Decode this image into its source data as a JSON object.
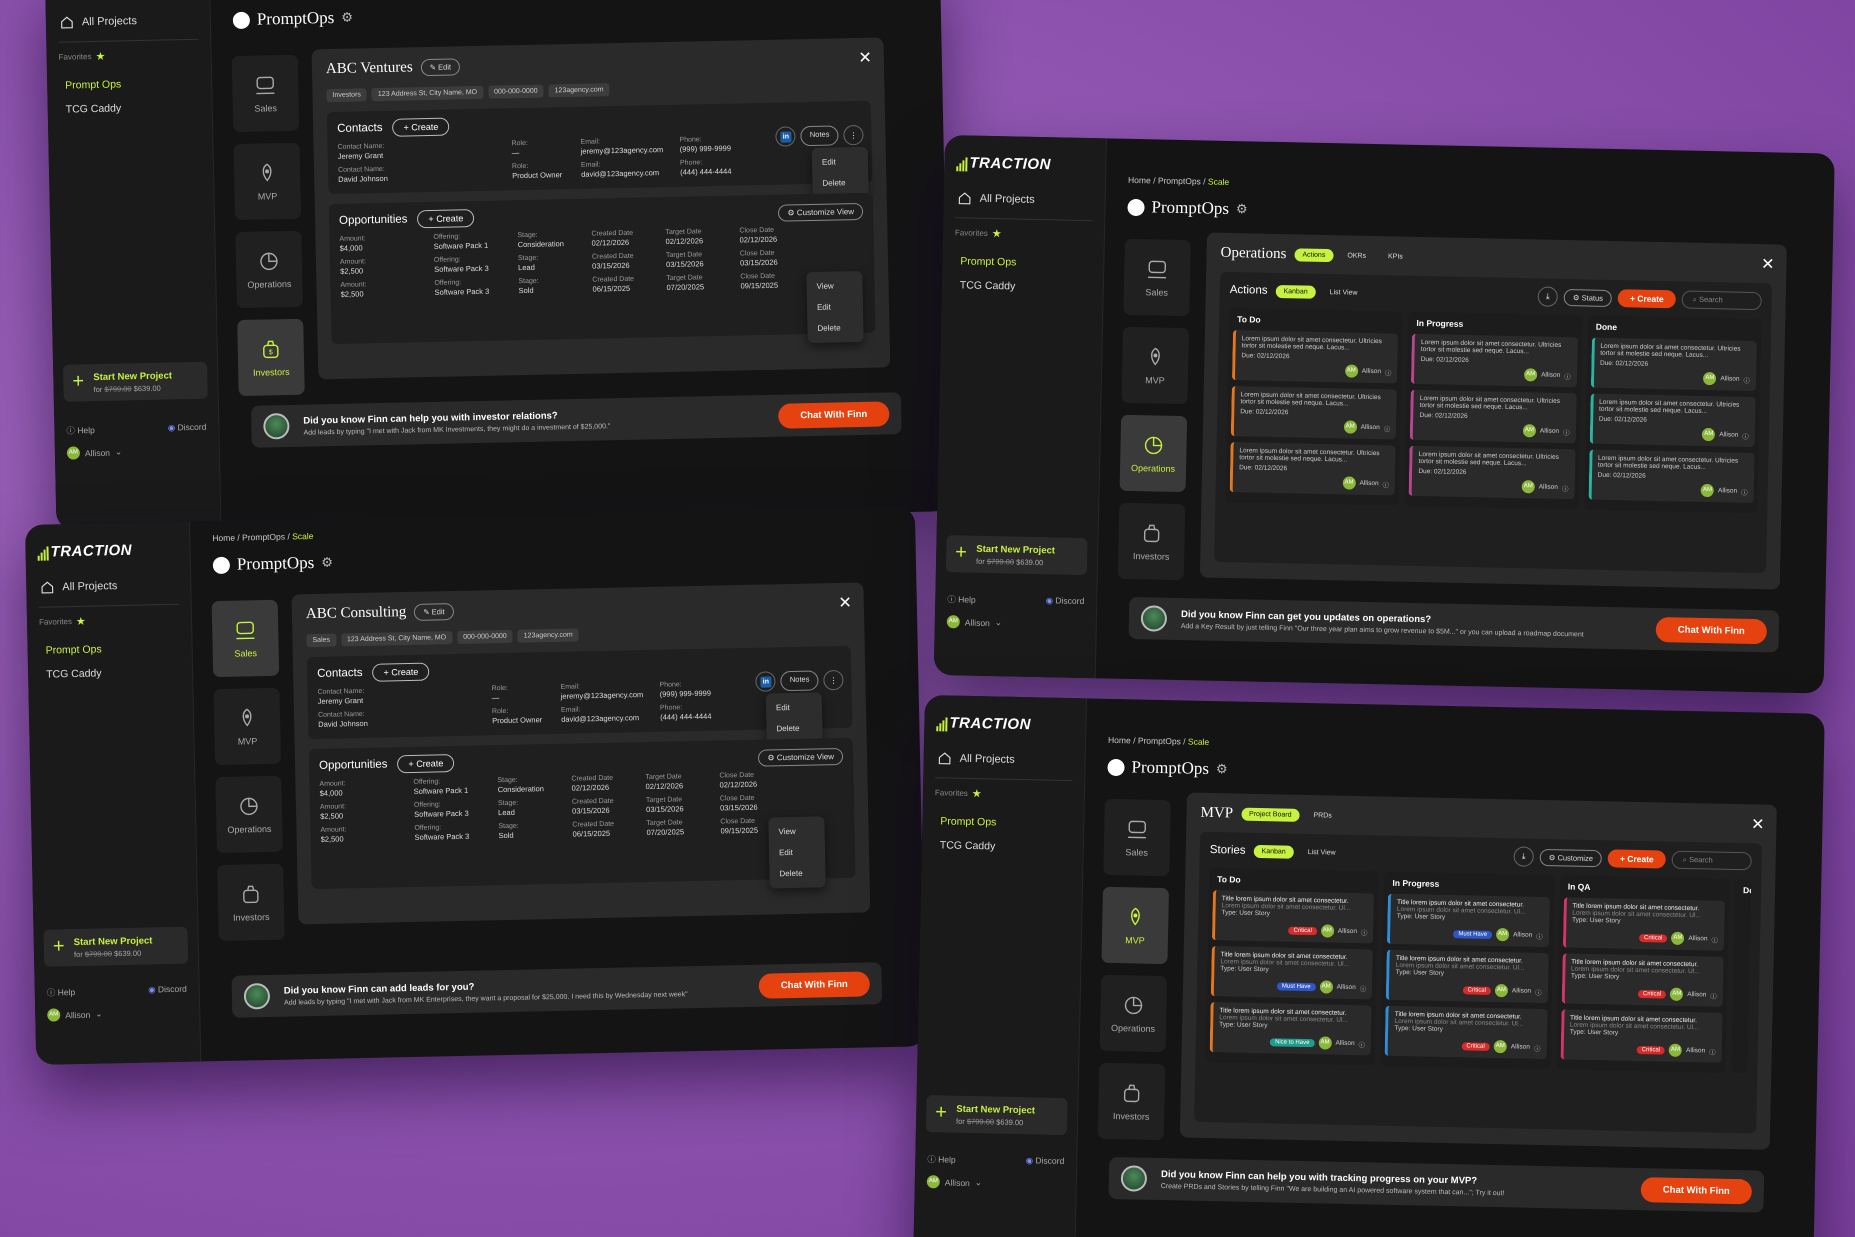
{
  "common": {
    "logo": "TRACTION",
    "all_projects": "All Projects",
    "favorites": "Favorites",
    "projects": [
      "Prompt Ops",
      "TCG Caddy"
    ],
    "start_new": "Start New Project",
    "price_old": "$799.00",
    "price_new": "$639.00",
    "price_for": "for",
    "help": "Help",
    "discord": "Discord",
    "user": "Allison",
    "crumb_home": "Home",
    "crumb_mid": "PromptOps",
    "crumb_cur": "Scale",
    "page_title": "PromptOps",
    "rail": [
      "Sales",
      "MVP",
      "Operations",
      "Investors"
    ],
    "chat": "Chat With Finn",
    "create": "+ Create",
    "edit": "Edit",
    "notes": "Notes",
    "delete": "Delete",
    "view": "View",
    "customize_view": "Customize View"
  },
  "investors_win": {
    "name": "ABC Ventures",
    "tags": [
      "Investors",
      "123 Address St, City Name, MO",
      "000-000-0000",
      "123agency.com"
    ],
    "contacts": [
      {
        "name": "Jeremy Grant",
        "role": "—",
        "email": "jeremy@123agency.com",
        "phone": "(999) 999-9999"
      },
      {
        "name": "David Johnson",
        "role": "Product Owner",
        "email": "david@123agency.com",
        "phone": "(444) 444-4444"
      }
    ],
    "opps": [
      {
        "amount": "$4,000",
        "offering": "Software Pack 1",
        "stage": "Consideration",
        "created": "02/12/2026",
        "target": "02/12/2026",
        "close": "02/12/2026"
      },
      {
        "amount": "$2,500",
        "offering": "Software Pack 3",
        "stage": "Lead",
        "created": "03/15/2026",
        "target": "03/15/2026",
        "close": "03/15/2026"
      },
      {
        "amount": "$2,500",
        "offering": "Software Pack 3",
        "stage": "Sold",
        "created": "06/15/2025",
        "target": "07/20/2025",
        "close": "09/15/2025"
      }
    ],
    "cta_h": "Did you know Finn can help you with investor relations?",
    "cta_s": "Add leads by typing \"I met with Jack from MK Investments, they might do a investment of $25,000.\""
  },
  "sales_win": {
    "name": "ABC Consulting",
    "tags": [
      "Sales",
      "123 Address St, City Name, MO",
      "000-000-0000",
      "123agency.com"
    ],
    "cta_h": "Did you know Finn can add leads for you?",
    "cta_s": "Add leads by typing \"I met with Jack from MK Enterprises, they want a proposal for $25,000. I need this by  Wednesday next week\""
  },
  "ops_win": {
    "name": "Operations",
    "tabs": [
      "Actions",
      "OKRs",
      "KPIs"
    ],
    "section": "Actions",
    "views": [
      "Kanban",
      "List View"
    ],
    "status": "Status",
    "search": "Search",
    "columns": [
      "To Do",
      "In Progress",
      "Done"
    ],
    "card_text": "Lorem ipsum dolor sit amet consectetur. Ultricies tortor sit molestie sed neque. Lacus...",
    "due": "Due:",
    "due_date": "02/12/2026",
    "cta_h": "Did you know Finn can get you updates on operations?",
    "cta_s": "Add a Key Result by just telling Finn \"Our three year plan aims to grow revenue to $5M...\" or you can upload a roadmap document"
  },
  "mvp_win": {
    "name": "MVP",
    "tabs": [
      "Project Board",
      "PRDs"
    ],
    "section": "Stories",
    "views": [
      "Kanban",
      "List View"
    ],
    "customize": "Customize",
    "search": "Search",
    "columns": [
      "To Do",
      "In Progress",
      "In QA",
      "Dor"
    ],
    "card_title": "Title lorem ipsum dolor sit amet consectetur.",
    "card_sub": "Lorem ipsum dolor sit amet consectetur. Ul...",
    "type": "Type:",
    "story": "User Story",
    "badges": [
      "Critical",
      "Must Have",
      "Nice to Have"
    ],
    "cta_h": "Did you know Finn can help you with tracking progress on your MVP?",
    "cta_s": "Create PRDs and Stories by telling Finn \"We are building an AI powered software system that can...\"; Try it out!"
  },
  "colors": {
    "accent": "#c7f23f",
    "cta": "#e6420f",
    "bg": "#141414"
  }
}
